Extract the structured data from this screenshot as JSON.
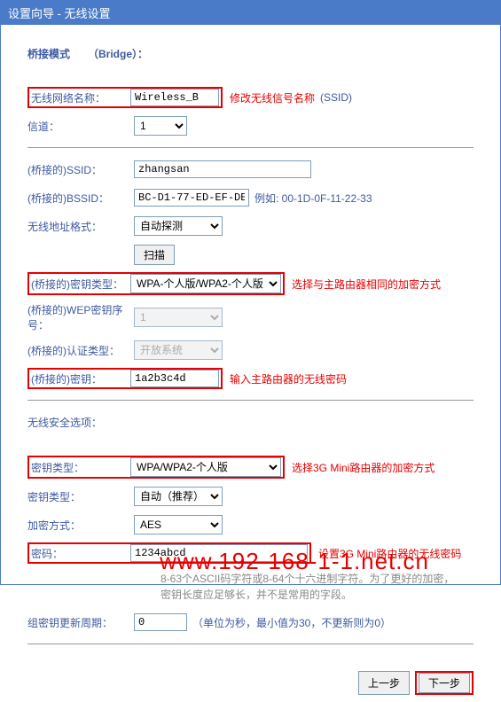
{
  "titlebar": "设置向导 - 无线设置",
  "bridge_mode": {
    "label": "桥接模式",
    "value": "（Bridge）："
  },
  "ssid_row": {
    "label": "无线网络名称：",
    "value": "Wireless_B",
    "anno": "修改无线信号名称",
    "suffix": "(SSID)"
  },
  "channel": {
    "label": "信道：",
    "value": "1"
  },
  "bridge_ssid": {
    "label": "(桥接的)SSID：",
    "value": "zhangsan"
  },
  "bridge_bssid": {
    "label": "(桥接的)BSSID：",
    "value": "BC-D1-77-ED-EF-DE",
    "example": "例如: 00-1D-0F-11-22-33"
  },
  "addr_format": {
    "label": "无线地址格式：",
    "value": "自动探测"
  },
  "scan_btn": "扫描",
  "bridge_keytype": {
    "label": "(桥接的)密钥类型：",
    "value": "WPA-个人版/WPA2-个人版",
    "anno": "选择与主路由器相同的加密方式"
  },
  "wep_index": {
    "label": "(桥接的)WEP密钥序号：",
    "value": "1"
  },
  "auth_type": {
    "label": "(桥接的)认证类型：",
    "value": "开放系统"
  },
  "bridge_key": {
    "label": "(桥接的)密钥：",
    "value": "1a2b3c4d",
    "anno": "输入主路由器的无线密码"
  },
  "security_section": "无线安全选项：",
  "keytype1": {
    "label": "密钥类型：",
    "value": "WPA/WPA2-个人版",
    "anno": "选择3G Mini路由器的加密方式"
  },
  "keytype2": {
    "label": "密钥类型：",
    "value": "自动（推荐）"
  },
  "crypto": {
    "label": "加密方式：",
    "value": "AES"
  },
  "password": {
    "label": "密码：",
    "value": "1234abcd",
    "anno": "设置3G Mini路由器的无线密码"
  },
  "pwd_hint": "8-63个ASCII码字符或8-64个十六进制字符。为了更好的加密，密钥长度应足够长，并不是常用的字段。",
  "group_key": {
    "label": "组密钥更新周期：",
    "value": "0",
    "note": "（单位为秒，最小值为30，不更新则为0）"
  },
  "buttons": {
    "prev": "上一步",
    "next": "下一步"
  },
  "watermark": "www.192-168-1-1.net.cn"
}
